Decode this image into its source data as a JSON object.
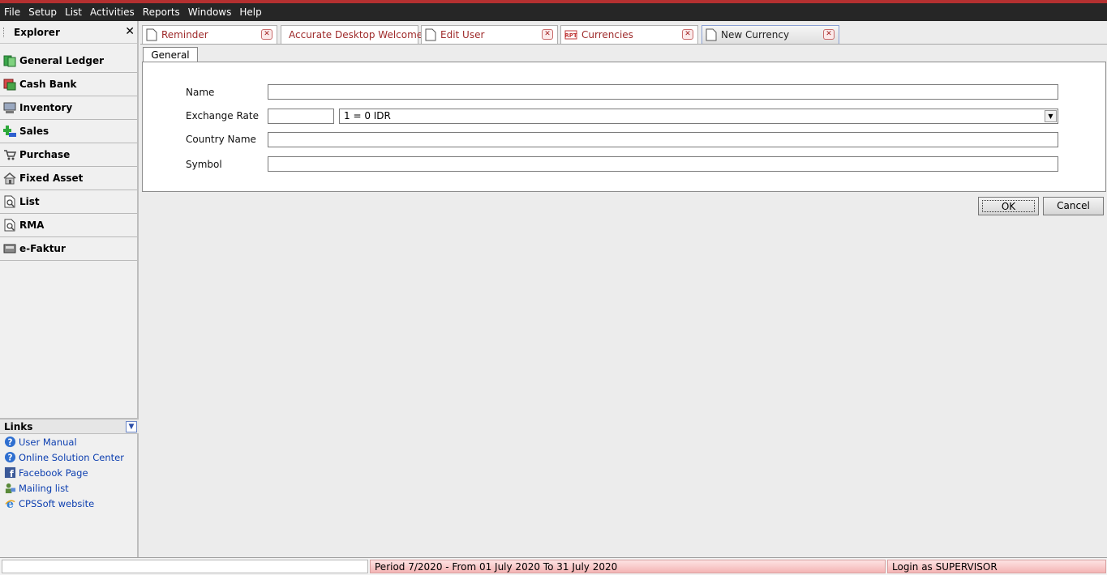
{
  "menubar": {
    "items": [
      {
        "label": "File"
      },
      {
        "label": "Setup"
      },
      {
        "label": "List"
      },
      {
        "label": "Activities"
      },
      {
        "label": "Reports"
      },
      {
        "label": "Windows"
      },
      {
        "label": "Help"
      }
    ]
  },
  "explorer": {
    "title": "Explorer",
    "close_glyph": "✕",
    "items": [
      {
        "label": "General Ledger",
        "icon": "ledger-icon"
      },
      {
        "label": "Cash Bank",
        "icon": "cash-bank-icon"
      },
      {
        "label": "Inventory",
        "icon": "inventory-icon"
      },
      {
        "label": "Sales",
        "icon": "sales-icon"
      },
      {
        "label": "Purchase",
        "icon": "cart-icon"
      },
      {
        "label": "Fixed Asset",
        "icon": "house-icon"
      },
      {
        "label": "List",
        "icon": "list-icon"
      },
      {
        "label": "RMA",
        "icon": "rma-icon"
      },
      {
        "label": "e-Faktur",
        "icon": "efaktur-icon"
      }
    ]
  },
  "links": {
    "title": "Links",
    "items": [
      {
        "label": "User Manual",
        "icon": "help-icon"
      },
      {
        "label": "Online Solution Center",
        "icon": "help-icon"
      },
      {
        "label": "Facebook Page",
        "icon": "facebook-icon"
      },
      {
        "label": "Mailing list",
        "icon": "mailing-icon"
      },
      {
        "label": "CPSSoft website",
        "icon": "ie-icon"
      }
    ]
  },
  "tabs": [
    {
      "label": "Reminder",
      "icon": "document-icon"
    },
    {
      "label": "Accurate Desktop Welcome...",
      "icon": "ie-icon"
    },
    {
      "label": "Edit User",
      "icon": "document-icon"
    },
    {
      "label": "Currencies",
      "icon": "report-icon"
    },
    {
      "label": "New Currency",
      "icon": "document-icon",
      "active": true
    }
  ],
  "form": {
    "subtab": "General",
    "name_label": "Name",
    "name_value": "",
    "rate_label": "Exchange Rate",
    "rate_value": "",
    "rate_display": "1  = 0 IDR",
    "country_label": "Country Name",
    "country_value": "",
    "symbol_label": "Symbol",
    "symbol_value": ""
  },
  "buttons": {
    "ok_label": "OK",
    "cancel_label": "Cancel"
  },
  "status": {
    "left": "",
    "period": "Period 7/2020 - From 01 July 2020 To 31 July 2020",
    "login": "Login as SUPERVISOR"
  }
}
